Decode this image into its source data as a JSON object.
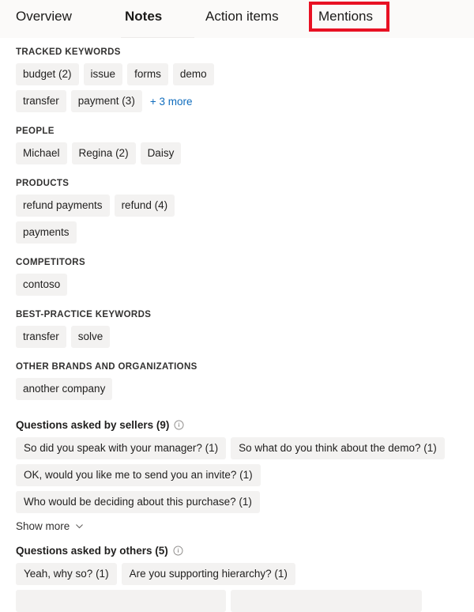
{
  "tabs": [
    {
      "label": "Overview",
      "selected": false,
      "highlighted": false
    },
    {
      "label": "Notes",
      "selected": true,
      "highlighted": false
    },
    {
      "label": "Action items",
      "selected": false,
      "highlighted": false
    },
    {
      "label": "Mentions",
      "selected": false,
      "highlighted": true
    }
  ],
  "highlight_color": "#e81123",
  "accent_link_color": "#0f6cbd",
  "chip_background": "#f3f2f1",
  "sections": [
    {
      "label": "TRACKED KEYWORDS",
      "chips": [
        "budget (2)",
        "issue",
        "forms",
        "demo",
        "transfer",
        "payment (3)"
      ],
      "more_link": "+ 3 more"
    },
    {
      "label": "PEOPLE",
      "chips": [
        "Michael",
        "Regina (2)",
        "Daisy"
      ]
    },
    {
      "label": "PRODUCTS",
      "chips": [
        "refund payments",
        "refund (4)",
        "payments"
      ]
    },
    {
      "label": "COMPETITORS",
      "chips": [
        "contoso"
      ]
    },
    {
      "label": "BEST-PRACTICE KEYWORDS",
      "chips": [
        "transfer",
        "solve"
      ]
    },
    {
      "label": "OTHER BRANDS AND ORGANIZATIONS",
      "chips": [
        "another company"
      ]
    }
  ],
  "questions_sellers": {
    "title": "Questions asked by sellers (9)",
    "info_icon": "info-circle-icon",
    "chips": [
      "So did you speak with your manager? (1)",
      "So what do you think about the demo? (1)",
      "OK, would you like me to send you an invite? (1)",
      "Who would be deciding about this purchase? (1)"
    ],
    "show_more_label": "Show more",
    "show_more_icon": "chevron-down-icon"
  },
  "questions_others": {
    "title": "Questions asked by others (5)",
    "info_icon": "info-circle-icon",
    "chips": [
      "Yeah, why so? (1)",
      "Are you supporting hierarchy? (1)"
    ]
  }
}
